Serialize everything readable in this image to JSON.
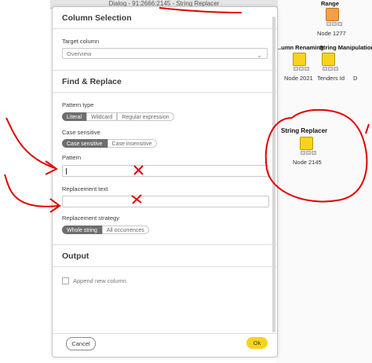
{
  "window": {
    "title": "Dialog - 91:2666:2145 - String Replacer"
  },
  "dialog": {
    "column_selection": {
      "heading": "Column Selection",
      "target_label": "Target column",
      "target_value": "Overview"
    },
    "find_replace": {
      "heading": "Find & Replace",
      "pattern_type_label": "Pattern type",
      "pattern_type_options": [
        "Literal",
        "Wildcard",
        "Regular expression"
      ],
      "pattern_type_selected": "Literal",
      "case_label": "Case sensitive",
      "case_options": [
        "Case sensitive",
        "Case insensitive"
      ],
      "case_selected": "Case sensitive",
      "pattern_label": "Pattern",
      "pattern_value": "",
      "replacement_label": "Replacement text",
      "replacement_value": "",
      "strategy_label": "Replacement strategy",
      "strategy_options": [
        "Whole string",
        "All occurrences"
      ],
      "strategy_selected": "Whole string"
    },
    "output": {
      "heading": "Output",
      "append_label": "Append new column",
      "append_checked": false
    },
    "buttons": {
      "cancel": "Cancel",
      "ok": "Ok"
    }
  },
  "workflow": {
    "nodes": [
      {
        "title": "Range",
        "label": "Node 1277",
        "color": "orange"
      },
      {
        "title": "...umn Renaming",
        "label": "Node 2021",
        "color": "yellow"
      },
      {
        "title": "String Manipulation",
        "label": "Tenders Id",
        "color": "yellow"
      },
      {
        "title": "String Replacer",
        "label": "Node 2145",
        "color": "yellow"
      }
    ],
    "extra_label": "D"
  },
  "colors": {
    "accent": "#f7d31c",
    "annotation": "#e00000",
    "selected_segment": "#6e6e6e"
  }
}
